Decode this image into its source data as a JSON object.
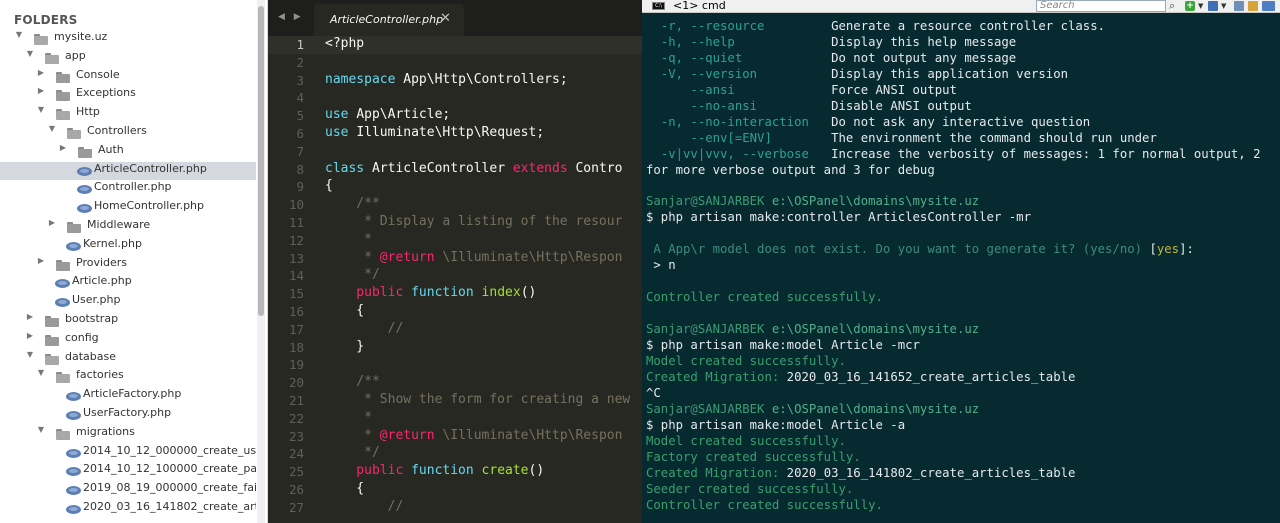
{
  "sidebar": {
    "header": "FOLDERS",
    "items": [
      {
        "label": "mysite.uz",
        "depth": 0,
        "type": "folder",
        "expanded": true
      },
      {
        "label": "app",
        "depth": 1,
        "type": "folder",
        "expanded": true
      },
      {
        "label": "Console",
        "depth": 2,
        "type": "folder",
        "expanded": false
      },
      {
        "label": "Exceptions",
        "depth": 2,
        "type": "folder",
        "expanded": false
      },
      {
        "label": "Http",
        "depth": 2,
        "type": "folder",
        "expanded": true
      },
      {
        "label": "Controllers",
        "depth": 3,
        "type": "folder",
        "expanded": true
      },
      {
        "label": "Auth",
        "depth": 4,
        "type": "folder",
        "expanded": false
      },
      {
        "label": "ArticleController.php",
        "depth": 4,
        "type": "file",
        "selected": true
      },
      {
        "label": "Controller.php",
        "depth": 4,
        "type": "file"
      },
      {
        "label": "HomeController.php",
        "depth": 4,
        "type": "file"
      },
      {
        "label": "Middleware",
        "depth": 3,
        "type": "folder",
        "expanded": false
      },
      {
        "label": "Kernel.php",
        "depth": 3,
        "type": "file"
      },
      {
        "label": "Providers",
        "depth": 2,
        "type": "folder",
        "expanded": false
      },
      {
        "label": "Article.php",
        "depth": 2,
        "type": "file"
      },
      {
        "label": "User.php",
        "depth": 2,
        "type": "file"
      },
      {
        "label": "bootstrap",
        "depth": 1,
        "type": "folder",
        "expanded": false
      },
      {
        "label": "config",
        "depth": 1,
        "type": "folder",
        "expanded": false
      },
      {
        "label": "database",
        "depth": 1,
        "type": "folder",
        "expanded": true
      },
      {
        "label": "factories",
        "depth": 2,
        "type": "folder",
        "expanded": true
      },
      {
        "label": "ArticleFactory.php",
        "depth": 3,
        "type": "file"
      },
      {
        "label": "UserFactory.php",
        "depth": 3,
        "type": "file"
      },
      {
        "label": "migrations",
        "depth": 2,
        "type": "folder",
        "expanded": true
      },
      {
        "label": "2014_10_12_000000_create_users_ta",
        "depth": 3,
        "type": "file"
      },
      {
        "label": "2014_10_12_100000_create_passwo",
        "depth": 3,
        "type": "file"
      },
      {
        "label": "2019_08_19_000000_create_failed_jo",
        "depth": 3,
        "type": "file"
      },
      {
        "label": "2020_03_16_141802_create_articles_",
        "depth": 3,
        "type": "file"
      }
    ]
  },
  "editor": {
    "tab_nav": "◀ ▶",
    "tab_title": "ArticleController.php",
    "tab_close": "✕",
    "current_line": 1,
    "line_numbers": [
      "1",
      "2",
      "3",
      "4",
      "5",
      "6",
      "7",
      "8",
      "9",
      "10",
      "11",
      "12",
      "13",
      "14",
      "15",
      "16",
      "17",
      "18",
      "19",
      "20",
      "21",
      "22",
      "23",
      "24",
      "25",
      "26",
      "27"
    ],
    "lines": [
      [
        {
          "t": "<?php",
          "c": "tag"
        }
      ],
      [],
      [
        {
          "t": "namespace ",
          "c": "kw"
        },
        {
          "t": "App\\Http\\Controllers;",
          "c": ""
        }
      ],
      [],
      [
        {
          "t": "use ",
          "c": "kw"
        },
        {
          "t": "App\\Article;",
          "c": ""
        }
      ],
      [
        {
          "t": "use ",
          "c": "kw"
        },
        {
          "t": "Illuminate\\Http\\Request;",
          "c": ""
        }
      ],
      [],
      [
        {
          "t": "class ",
          "c": "kw"
        },
        {
          "t": "ArticleController ",
          "c": ""
        },
        {
          "t": "extends ",
          "c": "pink"
        },
        {
          "t": "Contro",
          "c": ""
        }
      ],
      [
        {
          "t": "{",
          "c": ""
        }
      ],
      [
        {
          "t": "    /**",
          "c": "cm"
        }
      ],
      [
        {
          "t": "     * Display a listing of the resour",
          "c": "cm"
        }
      ],
      [
        {
          "t": "     *",
          "c": "cm"
        }
      ],
      [
        {
          "t": "     * ",
          "c": "cm"
        },
        {
          "t": "@return",
          "c": "ann"
        },
        {
          "t": " \\Illuminate\\Http\\Respon",
          "c": "cm"
        }
      ],
      [
        {
          "t": "     */",
          "c": "cm"
        }
      ],
      [
        {
          "t": "    public ",
          "c": "pink"
        },
        {
          "t": "function ",
          "c": "kw"
        },
        {
          "t": "index",
          "c": "fn"
        },
        {
          "t": "()",
          "c": ""
        }
      ],
      [
        {
          "t": "    {",
          "c": ""
        }
      ],
      [
        {
          "t": "        //",
          "c": "cm"
        }
      ],
      [
        {
          "t": "    }",
          "c": ""
        }
      ],
      [],
      [
        {
          "t": "    /**",
          "c": "cm"
        }
      ],
      [
        {
          "t": "     * Show the form for creating a new",
          "c": "cm"
        }
      ],
      [
        {
          "t": "     *",
          "c": "cm"
        }
      ],
      [
        {
          "t": "     * ",
          "c": "cm"
        },
        {
          "t": "@return",
          "c": "ann"
        },
        {
          "t": " \\Illuminate\\Http\\Respon",
          "c": "cm"
        }
      ],
      [
        {
          "t": "     */",
          "c": "cm"
        }
      ],
      [
        {
          "t": "    public ",
          "c": "pink"
        },
        {
          "t": "function ",
          "c": "kw"
        },
        {
          "t": "create",
          "c": "fn"
        },
        {
          "t": "()",
          "c": ""
        }
      ],
      [
        {
          "t": "    {",
          "c": ""
        }
      ],
      [
        {
          "t": "        //",
          "c": "cm"
        }
      ]
    ]
  },
  "terminal": {
    "title": "<1> cmd",
    "icon_label": "C:\\",
    "search_placeholder": "Search",
    "plus_label": "+",
    "colors": {
      "background": "#062a2f",
      "option": "#2aa198",
      "success": "#3b9f6e",
      "warning_yes": "#c4b43a"
    },
    "lines": [
      [
        {
          "t": "  -r, --resource         ",
          "c": "t-opt"
        },
        {
          "t": "Generate a resource controller class.",
          "c": "t-white"
        }
      ],
      [
        {
          "t": "  -h, --help             ",
          "c": "t-opt"
        },
        {
          "t": "Display this help message",
          "c": "t-white"
        }
      ],
      [
        {
          "t": "  -q, --quiet            ",
          "c": "t-opt"
        },
        {
          "t": "Do not output any message",
          "c": "t-white"
        }
      ],
      [
        {
          "t": "  -V, --version          ",
          "c": "t-opt"
        },
        {
          "t": "Display this application version",
          "c": "t-white"
        }
      ],
      [
        {
          "t": "      --ansi             ",
          "c": "t-opt"
        },
        {
          "t": "Force ANSI output",
          "c": "t-white"
        }
      ],
      [
        {
          "t": "      --no-ansi          ",
          "c": "t-opt"
        },
        {
          "t": "Disable ANSI output",
          "c": "t-white"
        }
      ],
      [
        {
          "t": "  -n, --no-interaction   ",
          "c": "t-opt"
        },
        {
          "t": "Do not ask any interactive question",
          "c": "t-white"
        }
      ],
      [
        {
          "t": "      --env[=ENV]        ",
          "c": "t-opt"
        },
        {
          "t": "The environment the command should run under",
          "c": "t-white"
        }
      ],
      [
        {
          "t": "  -v|vv|vvv, --verbose   ",
          "c": "t-opt"
        },
        {
          "t": "Increase the verbosity of messages: 1 for normal output, 2",
          "c": "t-white"
        }
      ],
      [
        {
          "t": "for more verbose output and 3 for debug",
          "c": "t-white"
        }
      ],
      [],
      [
        {
          "t": "Sanjar@SANJARBEK ",
          "c": "t-prompt"
        },
        {
          "t": "e:\\OSPanel\\domains\\mysite.uz",
          "c": "t-path"
        }
      ],
      [
        {
          "t": "$ php artisan make:controller ArticlesController -mr",
          "c": "t-white"
        }
      ],
      [],
      [
        {
          "t": " A App\\r model does not exist. Do you want to generate it? (yes/no) ",
          "c": "t-warn"
        },
        {
          "t": "[",
          "c": "t-white"
        },
        {
          "t": "yes",
          "c": "t-yes"
        },
        {
          "t": "]:",
          "c": "t-white"
        }
      ],
      [
        {
          "t": " > n",
          "c": "t-white"
        }
      ],
      [],
      [
        {
          "t": "Controller created successfully.",
          "c": "t-green"
        }
      ],
      [],
      [
        {
          "t": "Sanjar@SANJARBEK ",
          "c": "t-prompt"
        },
        {
          "t": "e:\\OSPanel\\domains\\mysite.uz",
          "c": "t-path"
        }
      ],
      [
        {
          "t": "$ php artisan make:model Article -mcr",
          "c": "t-white"
        }
      ],
      [
        {
          "t": "Model created successfully.",
          "c": "t-green"
        }
      ],
      [
        {
          "t": "Created Migration: ",
          "c": "t-green"
        },
        {
          "t": "2020_03_16_141652_create_articles_table",
          "c": "t-white"
        }
      ],
      [
        {
          "t": "^C",
          "c": "t-white"
        }
      ],
      [
        {
          "t": "Sanjar@SANJARBEK ",
          "c": "t-prompt"
        },
        {
          "t": "e:\\OSPanel\\domains\\mysite.uz",
          "c": "t-path"
        }
      ],
      [
        {
          "t": "$ php artisan make:model Article -a",
          "c": "t-white"
        }
      ],
      [
        {
          "t": "Model created successfully.",
          "c": "t-green"
        }
      ],
      [
        {
          "t": "Factory created successfully.",
          "c": "t-green"
        }
      ],
      [
        {
          "t": "Created Migration: ",
          "c": "t-green"
        },
        {
          "t": "2020_03_16_141802_create_articles_table",
          "c": "t-white"
        }
      ],
      [
        {
          "t": "Seeder created successfully.",
          "c": "t-green"
        }
      ],
      [
        {
          "t": "Controller created successfully.",
          "c": "t-green"
        }
      ]
    ]
  }
}
